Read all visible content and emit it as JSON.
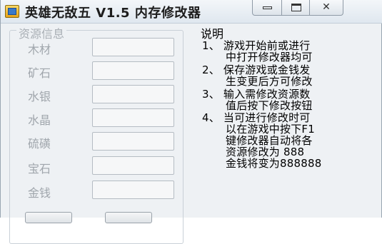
{
  "window": {
    "title": "英雄无敌五 V1.5 内存修改器",
    "close_glyph": "✕"
  },
  "resources": {
    "group_title": "资源信息",
    "items": [
      {
        "label": "木材",
        "value": ""
      },
      {
        "label": "矿石",
        "value": ""
      },
      {
        "label": "水银",
        "value": ""
      },
      {
        "label": "水晶",
        "value": ""
      },
      {
        "label": "硫磺",
        "value": ""
      },
      {
        "label": "宝石",
        "value": ""
      },
      {
        "label": "金钱",
        "value": ""
      }
    ]
  },
  "description": {
    "title": "说明",
    "lines": [
      "1、 游戏开始前或进行",
      "中打开修改器均可",
      "2、 保存游戏或金钱发",
      "生变更后方可修改",
      "3、 输入需修改资源数",
      "值后按下修改按钮",
      "4、 当可进行修改时可",
      "以在游戏中按下F1",
      "键修改器自动将各",
      "资源修改为 888",
      "金钱将变为888888"
    ]
  }
}
